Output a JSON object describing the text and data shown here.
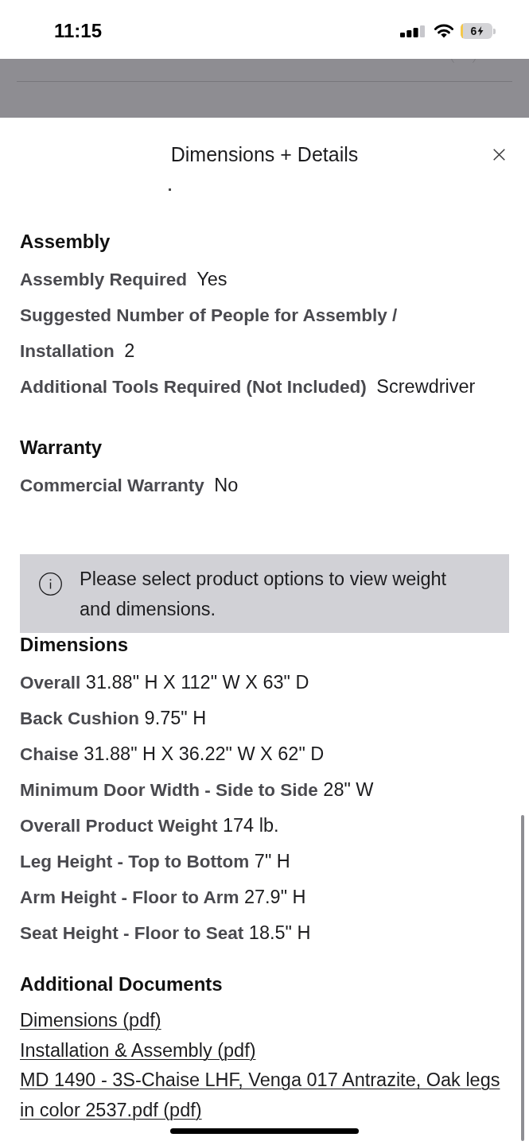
{
  "status_bar": {
    "time": "11:15",
    "battery": "6"
  },
  "sheet": {
    "title": "Dimensions + Details"
  },
  "sections": [
    {
      "kind": "specs",
      "heading": "Assembly",
      "rows": [
        {
          "label": "Assembly Required",
          "value": "Yes"
        },
        {
          "label": "Suggested Number of People for Assembly / Installation",
          "value": "2"
        },
        {
          "label": "Additional Tools Required (Not Included)",
          "value": "Screwdriver"
        }
      ]
    },
    {
      "kind": "specs",
      "heading": "Warranty",
      "rows": [
        {
          "label": "Commercial Warranty",
          "value": "No"
        }
      ]
    },
    {
      "kind": "notice",
      "text": "Please select product options to view weight and dimensions."
    },
    {
      "kind": "measurements",
      "heading": "Dimensions",
      "rows": [
        {
          "label": "Overall",
          "value": "31.88\" H X 112\" W X 63\" D"
        },
        {
          "label": "Back Cushion",
          "value": "9.75\" H"
        },
        {
          "label": "Chaise",
          "value": "31.88\" H X 36.22\" W X 62\" D"
        },
        {
          "label": "Minimum Door Width - Side to Side",
          "value": "28\" W"
        },
        {
          "label": "Overall Product Weight",
          "value": "174 lb."
        },
        {
          "label": "Leg Height - Top to Bottom",
          "value": "7\" H"
        },
        {
          "label": "Arm Height - Floor to Arm",
          "value": "27.9\" H"
        },
        {
          "label": "Seat Height - Floor to Seat",
          "value": "18.5\" H"
        }
      ]
    },
    {
      "kind": "documents",
      "heading": "Additional Documents",
      "links": [
        "Dimensions (pdf)",
        "Installation & Assembly (pdf)",
        "MD 1490 - 3S-Chaise LHF, Venga 017 Antrazite, Oak legs in color 2537.pdf (pdf)"
      ]
    }
  ]
}
